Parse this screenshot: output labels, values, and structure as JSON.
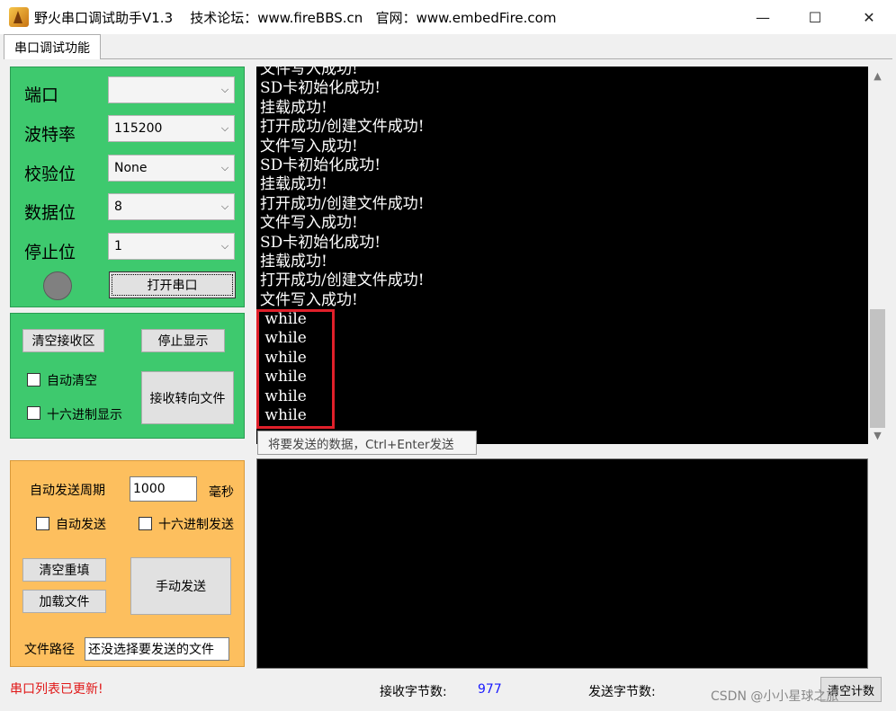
{
  "window": {
    "title": "野火串口调试助手V1.3    技术论坛：www.fireBBS.cn   官网：www.embedFire.com",
    "minimize": "—",
    "maximize": "☐",
    "close": "✕"
  },
  "tabs": [
    {
      "label": "串口调试功能"
    }
  ],
  "serial": {
    "port_label": "端口",
    "port_value": "",
    "baud_label": "波特率",
    "baud_value": "115200",
    "parity_label": "校验位",
    "parity_value": "None",
    "databits_label": "数据位",
    "databits_value": "8",
    "stopbits_label": "停止位",
    "stopbits_value": "1",
    "open_button": "打开串口",
    "status_led_color": "#808080"
  },
  "receive_controls": {
    "clear_button": "清空接收区",
    "stop_button": "停止显示",
    "auto_clear_label": "自动清空",
    "hex_display_label": "十六进制显示",
    "redirect_button": "接收转向文件"
  },
  "send_controls": {
    "period_label": "自动发送周期",
    "period_value": "1000",
    "period_unit": "毫秒",
    "auto_send_label": "自动发送",
    "hex_send_label": "十六进制发送",
    "clear_button": "清空重填",
    "load_button": "加载文件",
    "send_button": "手动发送",
    "file_path_label": "文件路径",
    "file_path_value": "还没选择要发送的文件"
  },
  "receive_text": [
    "文件写入成功!",
    "SD卡初始化成功!",
    "挂载成功!",
    "打开成功/创建文件成功!",
    "文件写入成功!",
    "SD卡初始化成功!",
    "挂载成功!",
    "打开成功/创建文件成功!",
    "文件写入成功!",
    "SD卡初始化成功!",
    "挂载成功!",
    "打开成功/创建文件成功!",
    "文件写入成功!",
    " while",
    " while",
    " while",
    " while",
    " while",
    " while"
  ],
  "send_placeholder_tooltip": "将要发送的数据，Ctrl+Enter发送",
  "status": {
    "message": "串口列表已更新!",
    "recv_bytes_label": "接收字节数:",
    "recv_bytes_value": "977",
    "send_bytes_label": "发送字节数:",
    "clear_count_button": "清空计数",
    "watermark": "CSDN @小小星球之旅"
  },
  "colors": {
    "serial_panel": "#3ec96e",
    "send_panel": "#fdbf5e",
    "highlight_box": "#e0202a",
    "status_message": "#e01818",
    "count_value": "#1a1aff"
  }
}
